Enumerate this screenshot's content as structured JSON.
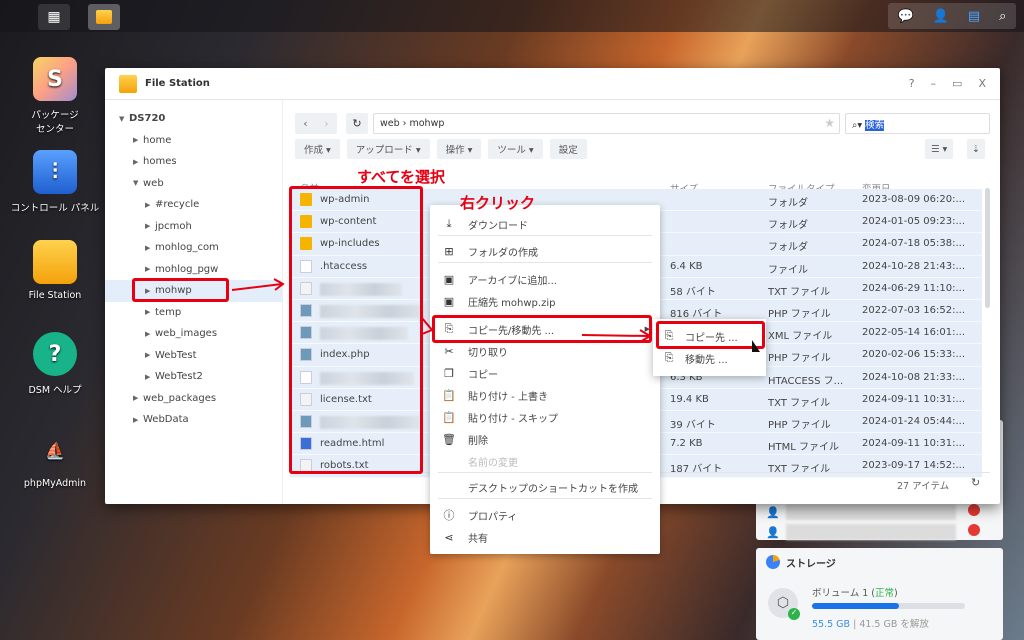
{
  "taskbar": {
    "main_menu_icon": "grid-icon",
    "file_station_icon": "folder-icon",
    "tray": [
      "chat-notification-icon",
      "user-icon",
      "widgets-icon",
      "search-icon"
    ]
  },
  "desktop": {
    "icons": [
      {
        "label": "パッケージ\nセンター",
        "icon": "package-center-icon"
      },
      {
        "label": "コントロール パネル",
        "icon": "control-panel-icon"
      },
      {
        "label": "File Station",
        "icon": "folder-icon"
      },
      {
        "label": "DSM ヘルプ",
        "icon": "help-icon"
      },
      {
        "label": "phpMyAdmin",
        "icon": "phpmyadmin-logo"
      }
    ]
  },
  "window": {
    "title": "File Station",
    "controls": [
      "?",
      "–",
      "▭",
      "X"
    ]
  },
  "sidebar": {
    "root": "DS720",
    "items": [
      {
        "label": "home",
        "level": 1,
        "expanded": false
      },
      {
        "label": "homes",
        "level": 1,
        "expanded": false
      },
      {
        "label": "web",
        "level": 1,
        "expanded": true
      },
      {
        "label": "#recycle",
        "level": 2
      },
      {
        "label": "jpcmoh",
        "level": 2
      },
      {
        "label": "mohlog_com",
        "level": 2
      },
      {
        "label": "mohlog_pgw",
        "level": 2
      },
      {
        "label": "mohwp",
        "level": 2,
        "selected": true
      },
      {
        "label": "temp",
        "level": 2
      },
      {
        "label": "web_images",
        "level": 2
      },
      {
        "label": "WebTest",
        "level": 2
      },
      {
        "label": "WebTest2",
        "level": 2
      },
      {
        "label": "web_packages",
        "level": 1
      },
      {
        "label": "WebData",
        "level": 1
      }
    ]
  },
  "toolbar": {
    "path": "web › mohwp",
    "search_placeholder": "検索",
    "buttons": [
      "作成 ▾",
      "アップロード ▾",
      "操作 ▾",
      "ツール ▾",
      "設定"
    ]
  },
  "table": {
    "columns": [
      "名前 ▴",
      "サイズ",
      "ファイルタイプ",
      "変更日"
    ],
    "rows": [
      {
        "name": "wp-admin",
        "icon": "folder",
        "size": "",
        "type": "フォルダ",
        "date": "2023-08-09 06:20:..."
      },
      {
        "name": "wp-content",
        "icon": "folder",
        "size": "",
        "type": "フォルダ",
        "date": "2024-01-05 09:23:..."
      },
      {
        "name": "wp-includes",
        "icon": "folder",
        "size": "",
        "type": "フォルダ",
        "date": "2024-07-18 05:38:..."
      },
      {
        "name": ".htaccess",
        "icon": "file",
        "size": "6.4 KB",
        "type": "ファイル",
        "date": "2024-10-28 21:43:..."
      },
      {
        "name": "",
        "icon": "txt",
        "size": "58 バイト",
        "type": "TXT ファイル",
        "date": "2024-06-29 11:10:..."
      },
      {
        "name": "",
        "icon": "code",
        "size": "816 バイト",
        "type": "PHP ファイル",
        "date": "2022-07-03 16:52:..."
      },
      {
        "name": "",
        "icon": "code",
        "size": "",
        "type": "XML ファイル",
        "date": "2022-05-14 16:01:..."
      },
      {
        "name": "index.php",
        "icon": "code",
        "size": "",
        "type": "PHP ファイル",
        "date": "2020-02-06 15:33:..."
      },
      {
        "name": "",
        "icon": "file",
        "size": "6.3 KB",
        "type": "HTACCESS フ...",
        "date": "2024-10-08 21:33:..."
      },
      {
        "name": "license.txt",
        "icon": "txt",
        "size": "19.4 KB",
        "type": "TXT ファイル",
        "date": "2024-09-11 10:31:..."
      },
      {
        "name": "",
        "icon": "code",
        "size": "39 バイト",
        "type": "PHP ファイル",
        "date": "2024-01-24 05:44:..."
      },
      {
        "name": "readme.html",
        "icon": "html",
        "size": "7.2 KB",
        "type": "HTML ファイル",
        "date": "2024-09-11 10:31:..."
      },
      {
        "name": "robots.txt",
        "icon": "txt",
        "size": "187 バイト",
        "type": "TXT ファイル",
        "date": "2023-09-17 14:52:..."
      }
    ]
  },
  "footer": {
    "count": "27 アイテム"
  },
  "context_menu": {
    "items": [
      {
        "label": "ダウンロード",
        "icon": "download-icon"
      },
      {
        "label": "フォルダの作成",
        "icon": "new-folder-icon"
      },
      {
        "label": "アーカイブに追加...",
        "icon": "archive-icon"
      },
      {
        "label": "圧縮先 mohwp.zip",
        "icon": "archive-icon"
      },
      {
        "label": "コピー先/移動先 ...",
        "icon": "copy-move-icon",
        "submenu": true
      },
      {
        "label": "切り取り",
        "icon": "scissors-icon"
      },
      {
        "label": "コピー",
        "icon": "copy-icon"
      },
      {
        "label": "貼り付け - 上書き",
        "icon": "paste-icon"
      },
      {
        "label": "貼り付け - スキップ",
        "icon": "paste-icon"
      },
      {
        "label": "削除",
        "icon": "trash-icon"
      },
      {
        "label": "名前の変更",
        "icon": "",
        "disabled": true
      },
      {
        "label": "デスクトップのショートカットを作成",
        "icon": ""
      },
      {
        "label": "プロパティ",
        "icon": "info-icon"
      },
      {
        "label": "共有",
        "icon": "share-icon"
      }
    ]
  },
  "submenu": {
    "items": [
      {
        "label": "コピー先 ..."
      },
      {
        "label": "移動先 ..."
      }
    ]
  },
  "annotations": {
    "select_all": "すべてを選択",
    "right_click": "右クリック",
    "color": "#e60012"
  },
  "widgets": {
    "storage": {
      "title": "ストレージ",
      "volume": "ボリューム 1",
      "status": "正常",
      "used": "55.5 GB",
      "free": "41.5 GB を解放",
      "usage_percent": 57
    }
  },
  "colors": {
    "accent": "#1a73e8",
    "selection": "#e6eff9",
    "folder": "#f4a10b",
    "ok": "#2db34a"
  }
}
